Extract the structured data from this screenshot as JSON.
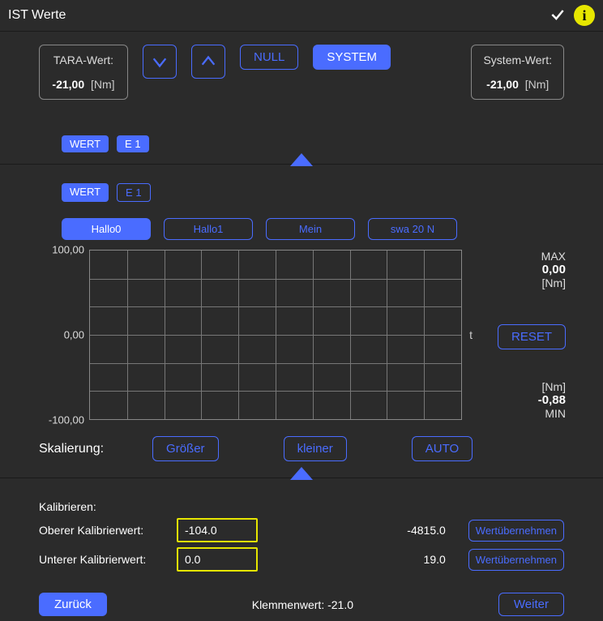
{
  "titlebar": {
    "title": "IST Werte"
  },
  "tara": {
    "label": "TARA-Wert:",
    "value": "-21,00",
    "unit": "[Nm]"
  },
  "system": {
    "label": "System-Wert:",
    "value": "-21,00",
    "unit": "[Nm]"
  },
  "buttons": {
    "null": "NULL",
    "system": "SYSTEM",
    "reset": "RESET",
    "groesser": "Größer",
    "kleiner": "kleiner",
    "auto": "AUTO",
    "uebernehmen": "Wertübernehmen",
    "zurueck": "Zurück",
    "weiter": "Weiter"
  },
  "chips": {
    "wert": "WERT",
    "e1": "E 1"
  },
  "tabs": [
    "Hallo0",
    "Hallo1",
    "Mein",
    "swa 20 N"
  ],
  "yaxis": {
    "top": "100,00",
    "mid": "0,00",
    "bot": "-100,00"
  },
  "xaxis": {
    "label": "t"
  },
  "maxblock": {
    "label": "MAX",
    "value": "0,00",
    "unit": "[Nm]"
  },
  "minblock": {
    "label": "MIN",
    "value": "-0,88",
    "unit": "[Nm]"
  },
  "scaling_label": "Skalierung:",
  "calib": {
    "heading": "Kalibrieren:",
    "upper_label": "Oberer Kalibrierwert:",
    "upper_value": "-104.0",
    "upper_raw": "-4815.0",
    "lower_label": "Unterer Kalibrierwert:",
    "lower_value": "0.0",
    "lower_raw": "19.0",
    "klemme": "Klemmenwert: -21.0"
  },
  "chart_data": {
    "type": "line",
    "title": "",
    "xlabel": "t",
    "ylabel": "",
    "ylim": [
      -100,
      100
    ],
    "yticks": [
      -100,
      0,
      100
    ],
    "series": [],
    "unit": "Nm"
  }
}
